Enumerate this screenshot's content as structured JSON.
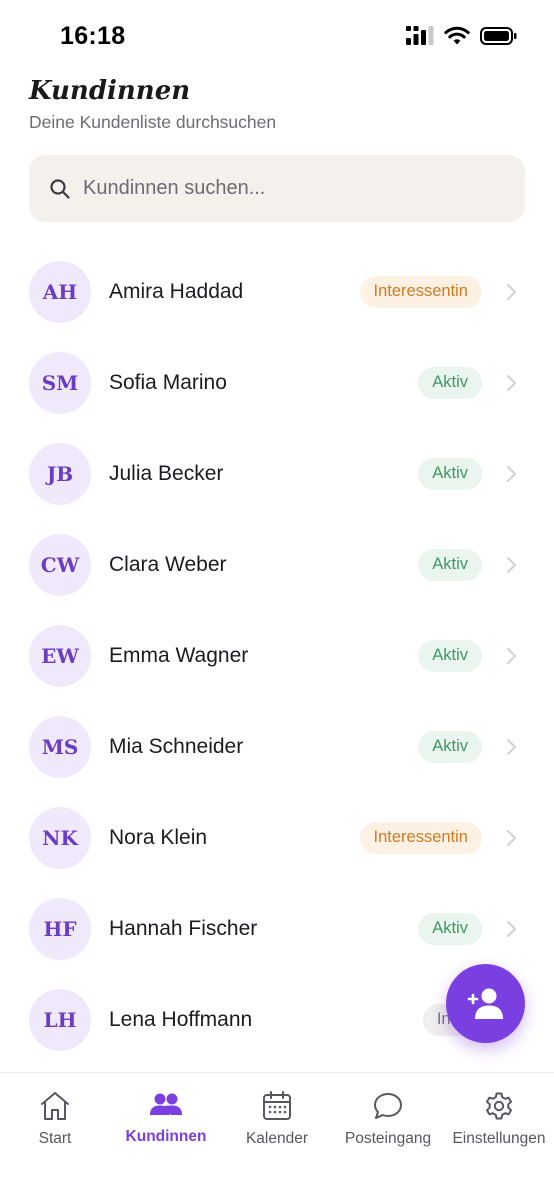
{
  "status_bar": {
    "time": "16:18"
  },
  "header": {
    "title": "Kundinnen",
    "subtitle": "Deine Kundenliste durchsuchen"
  },
  "search": {
    "placeholder": "Kundinnen suchen..."
  },
  "customers": [
    {
      "initials": "AH",
      "name": "Amira Haddad",
      "status": "Interessentin"
    },
    {
      "initials": "SM",
      "name": "Sofia Marino",
      "status": "Aktiv"
    },
    {
      "initials": "JB",
      "name": "Julia Becker",
      "status": "Aktiv"
    },
    {
      "initials": "CW",
      "name": "Clara Weber",
      "status": "Aktiv"
    },
    {
      "initials": "EW",
      "name": "Emma Wagner",
      "status": "Aktiv"
    },
    {
      "initials": "MS",
      "name": "Mia Schneider",
      "status": "Aktiv"
    },
    {
      "initials": "NK",
      "name": "Nora Klein",
      "status": "Interessentin"
    },
    {
      "initials": "HF",
      "name": "Hannah Fischer",
      "status": "Aktiv"
    },
    {
      "initials": "LH",
      "name": "Lena Hoffmann",
      "status": "Inak"
    }
  ],
  "tabs": [
    {
      "label": "Start",
      "icon": "home-icon"
    },
    {
      "label": "Kundinnen",
      "icon": "users-icon"
    },
    {
      "label": "Kalender",
      "icon": "calendar-icon"
    },
    {
      "label": "Posteingang",
      "icon": "chat-bubble-icon"
    },
    {
      "label": "Einstellungen",
      "icon": "gear-icon"
    }
  ],
  "fab": {
    "icon": "add-user-icon"
  },
  "colors": {
    "accent": "#7a3fe0",
    "avatar_bg": "#efe9fb",
    "search_bg": "#f4f1ed"
  }
}
